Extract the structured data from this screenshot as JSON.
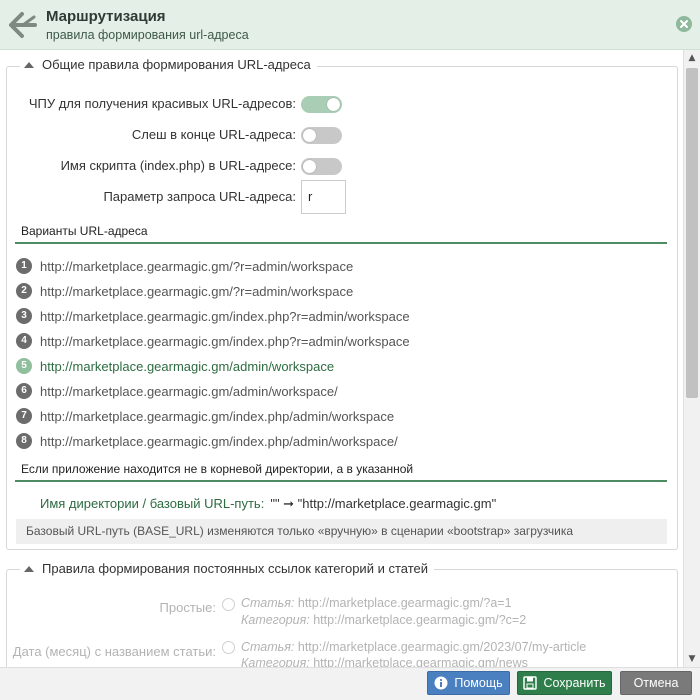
{
  "header": {
    "title": "Маршрутизация",
    "subtitle": "правила формирования url-адреса"
  },
  "group_general": {
    "legend": "Общие правила формирования URL-адреса",
    "fields": {
      "pretty_urls_label": "ЧПУ для получения красивых URL-адресов:",
      "pretty_urls_on": true,
      "trailing_slash_label": "Слеш в конце URL-адреса:",
      "trailing_slash_on": false,
      "script_name_label": "Имя скрипта (index.php) в URL-адресе:",
      "script_name_on": false,
      "query_param_label": "Параметр запроса URL-адреса:",
      "query_param_value": "r"
    },
    "variants_heading": "Варианты URL-адреса",
    "variants": [
      {
        "num": "1",
        "url": "http://marketplace.gearmagic.gm/?r=admin/workspace"
      },
      {
        "num": "2",
        "url": "http://marketplace.gearmagic.gm/?r=admin/workspace"
      },
      {
        "num": "3",
        "url": "http://marketplace.gearmagic.gm/index.php?r=admin/workspace"
      },
      {
        "num": "4",
        "url": "http://marketplace.gearmagic.gm/index.php?r=admin/workspace"
      },
      {
        "num": "5",
        "url": "http://marketplace.gearmagic.gm/admin/workspace"
      },
      {
        "num": "6",
        "url": "http://marketplace.gearmagic.gm/admin/workspace/"
      },
      {
        "num": "7",
        "url": "http://marketplace.gearmagic.gm/index.php/admin/workspace"
      },
      {
        "num": "8",
        "url": "http://marketplace.gearmagic.gm/index.php/admin/workspace/"
      }
    ],
    "active_variant": "5",
    "subdir_heading": "Если приложение находится не в корневой директории, а в указанной",
    "base_url_label": "Имя директории / базовый URL-путь:",
    "base_url_value": "\"\" ➞ \"http://marketplace.gearmagic.gm\"",
    "hint": "Базовый URL-путь (BASE_URL) изменяются только «вручную» в сценарии «bootstrap» загрузчика"
  },
  "group_permalinks": {
    "legend": "Правила формирования постоянных ссылок категорий и статей",
    "options": [
      {
        "label": "Простые:",
        "article_prefix": "Статья:",
        "article_url": "http://marketplace.gearmagic.gm/?a=1",
        "category_prefix": "Категория:",
        "category_url": "http://marketplace.gearmagic.gm/?c=2"
      },
      {
        "label": "Дата (месяц) с названием статьи:",
        "article_prefix": "Статья:",
        "article_url": "http://marketplace.gearmagic.gm/2023/07/my-article",
        "category_prefix": "Категория:",
        "category_url": "http://marketplace.gearmagic.gm/news"
      }
    ]
  },
  "footer": {
    "help_label": "Помощь",
    "save_label": "Сохранить",
    "cancel_label": "Отмена"
  },
  "colors": {
    "header_bg": "#e3efe7",
    "accent_green": "#2e7d4a",
    "help_blue": "#4a7fc0",
    "cancel_gray": "#7a7a7a"
  },
  "icons": {
    "back": "route-arrows-icon",
    "close": "close-icon",
    "help": "help-icon",
    "save": "save-icon"
  }
}
